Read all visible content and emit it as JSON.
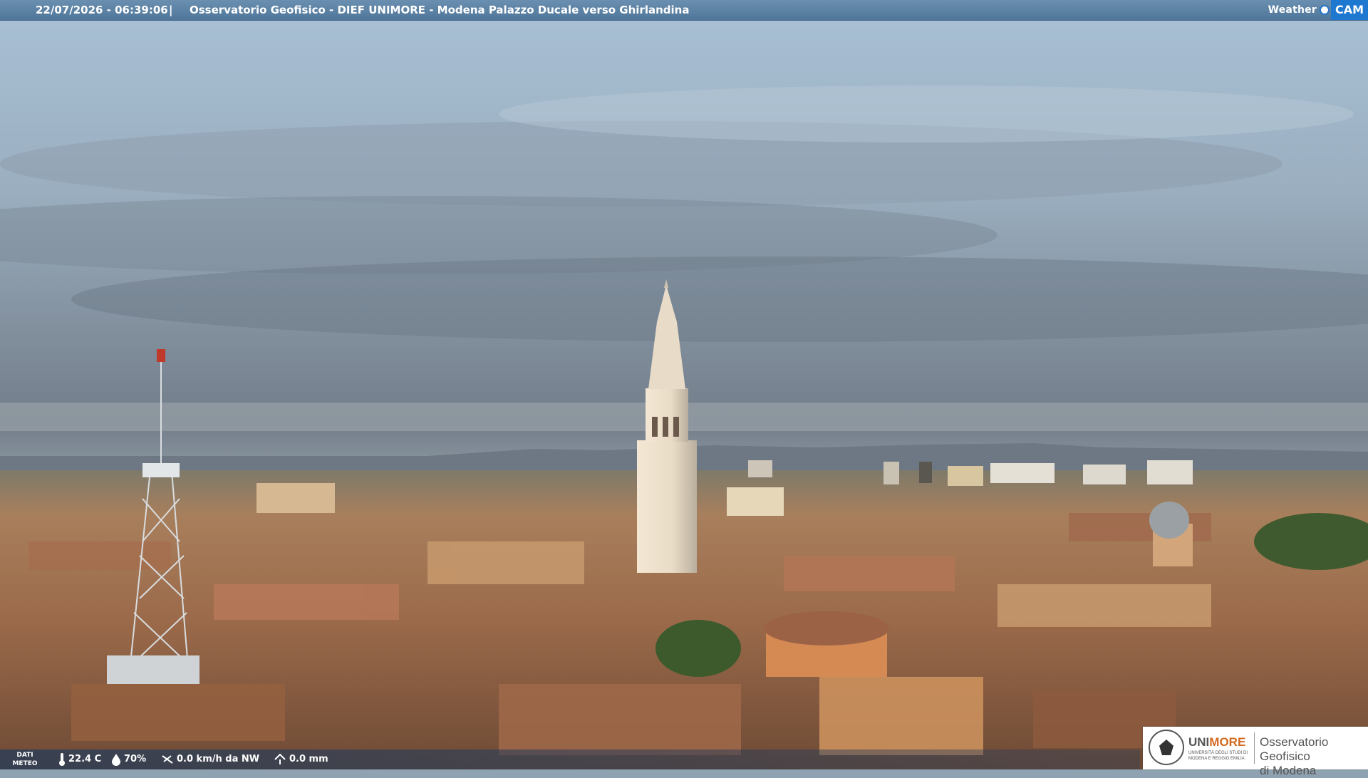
{
  "header": {
    "timestamp": "22/07/2026 - 06:39:06",
    "separator": "|",
    "title": "Osservatorio Geofisico - DIEF UNIMORE - Modena Palazzo Ducale verso Ghirlandina"
  },
  "brand": {
    "weather": "Weather",
    "cam": "CAM"
  },
  "weather": {
    "dati": "DATI",
    "meteo": "METEO",
    "temperature": "22.4 C",
    "humidity": "70%",
    "wind": "0.0 km/h da NW",
    "rain": "0.0 mm",
    "icons": [
      "thermometer-icon",
      "humidity-drop-icon",
      "wind-icon",
      "rain-gauge-icon"
    ]
  },
  "logo": {
    "uni_a": "UNI",
    "uni_b": "MORE",
    "uni_sub": "UNIVERSITÀ DEGLI STUDI DI MODENA E REGGIO EMILIA",
    "obs_line1": "Osservatorio Geofisico",
    "obs_line2": "di Modena"
  }
}
